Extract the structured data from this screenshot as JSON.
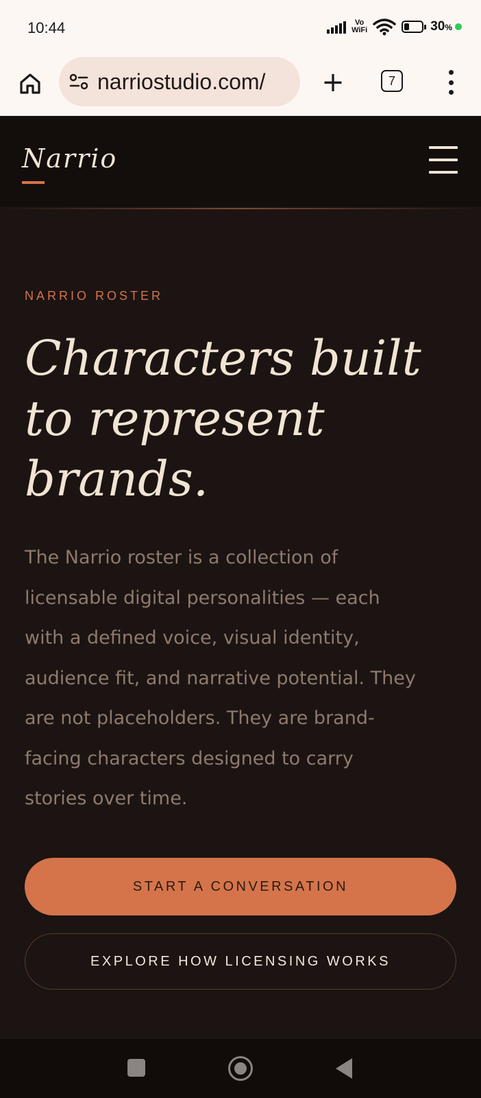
{
  "status_bar": {
    "time": "10:44",
    "vowifi_top": "Vo",
    "vowifi_bottom": "WiFi",
    "battery_percent": "30",
    "battery_unit": "%",
    "battery_level": 0.3,
    "icons": [
      "signal-icon",
      "vowifi-icon",
      "wifi-icon",
      "battery-icon",
      "charging-dot-icon"
    ]
  },
  "browser": {
    "url": "narriostudio.com/",
    "tab_count": "7",
    "new_tab_label": "+",
    "icons": [
      "home-icon",
      "site-settings-icon",
      "new-tab-icon",
      "tab-switcher-icon",
      "more-options-icon"
    ]
  },
  "site": {
    "logo": "Narrio",
    "accent_color": "#d5734a",
    "background_color": "#1b1412"
  },
  "hero": {
    "eyebrow": "NARRIO ROSTER",
    "title_lines": [
      "Characters built",
      "to represent",
      "brands."
    ],
    "body_lines": [
      "The Narrio roster is a collection of",
      "licensable digital personalities — each",
      "with a defined voice, visual identity,",
      "audience fit, and narrative potential. They",
      "are not placeholders. They are brand-",
      "facing characters designed to carry",
      "stories over time."
    ],
    "primary_cta": "START A CONVERSATION",
    "secondary_cta": "EXPLORE HOW LICENSING WORKS"
  },
  "android_nav": {
    "icons": [
      "recents-icon",
      "home-circle-icon",
      "back-icon"
    ]
  }
}
